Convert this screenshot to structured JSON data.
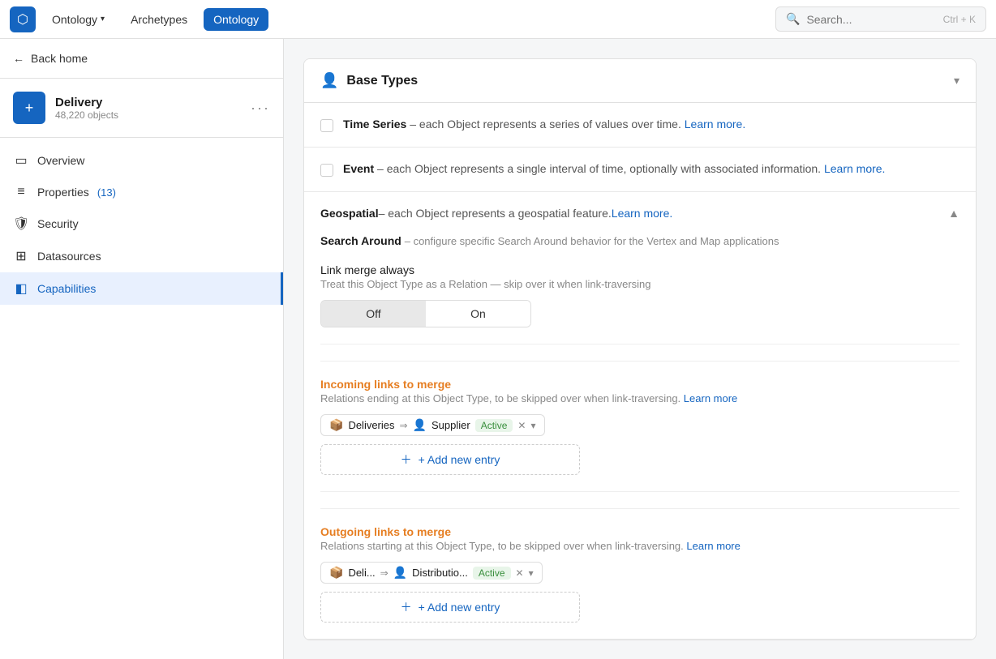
{
  "topNav": {
    "logo": "⬡",
    "ontologyDropdown": "Ontology",
    "archetypes": "Archetypes",
    "ontology": "Ontology",
    "search": {
      "placeholder": "Search...",
      "shortcut": "Ctrl + K"
    }
  },
  "sidebar": {
    "backHome": "Back home",
    "workspace": {
      "name": "Delivery",
      "count": "48,220 objects",
      "icon": "+"
    },
    "navItems": [
      {
        "id": "overview",
        "label": "Overview",
        "icon": "▭",
        "active": false
      },
      {
        "id": "properties",
        "label": "Properties",
        "badge": "(13)",
        "icon": "≡",
        "active": false
      },
      {
        "id": "security",
        "label": "Security",
        "icon": "🛡",
        "active": false
      },
      {
        "id": "datasources",
        "label": "Datasources",
        "icon": "⊞",
        "active": false
      },
      {
        "id": "capabilities",
        "label": "Capabilities",
        "icon": "◧",
        "active": true
      }
    ]
  },
  "mainPanel": {
    "title": "Base Types",
    "icon": "👤",
    "items": [
      {
        "id": "time-series",
        "name": "Time Series",
        "desc": " – each Object represents a series of values over time. ",
        "learnMore": "Learn more.",
        "checked": false,
        "expanded": false
      },
      {
        "id": "event",
        "name": "Event",
        "desc": " – each Object represents a single interval of time, optionally with associated information. ",
        "learnMore": "Learn more.",
        "checked": false,
        "expanded": false
      },
      {
        "id": "geospatial",
        "name": "Geospatial",
        "desc": " – each Object represents a geospatial feature. ",
        "learnMore": "Learn more.",
        "checked": false,
        "expanded": true
      }
    ],
    "geospatialSection": {
      "searchAround": {
        "title": "Search Around",
        "desc": " – configure specific Search Around behavior for the Vertex and Map applications"
      },
      "linkMerge": {
        "label": "Link merge always",
        "desc": "Treat this Object Type as a Relation — skip over it when link-traversing",
        "options": [
          "Off",
          "On"
        ],
        "selected": "Off"
      },
      "incomingLinks": {
        "label": "Incoming links to merge",
        "desc": "Relations ending at this Object Type, to be skipped over when link-traversing.",
        "learnMore": "Learn more",
        "tags": [
          {
            "source": "Deliveries",
            "arrow": "⇒",
            "target": "Supplier",
            "badge": "Active"
          }
        ],
        "addButton": "+ Add new entry"
      },
      "outgoingLinks": {
        "label": "Outgoing links to merge",
        "desc": "Relations starting at this Object Type, to be skipped over when link-traversing.",
        "learnMore": "Learn more",
        "tags": [
          {
            "source": "Deli...",
            "arrow": "⇒",
            "target": "Distributio...",
            "badge": "Active"
          }
        ],
        "addButton": "+ Add new entry"
      }
    }
  }
}
